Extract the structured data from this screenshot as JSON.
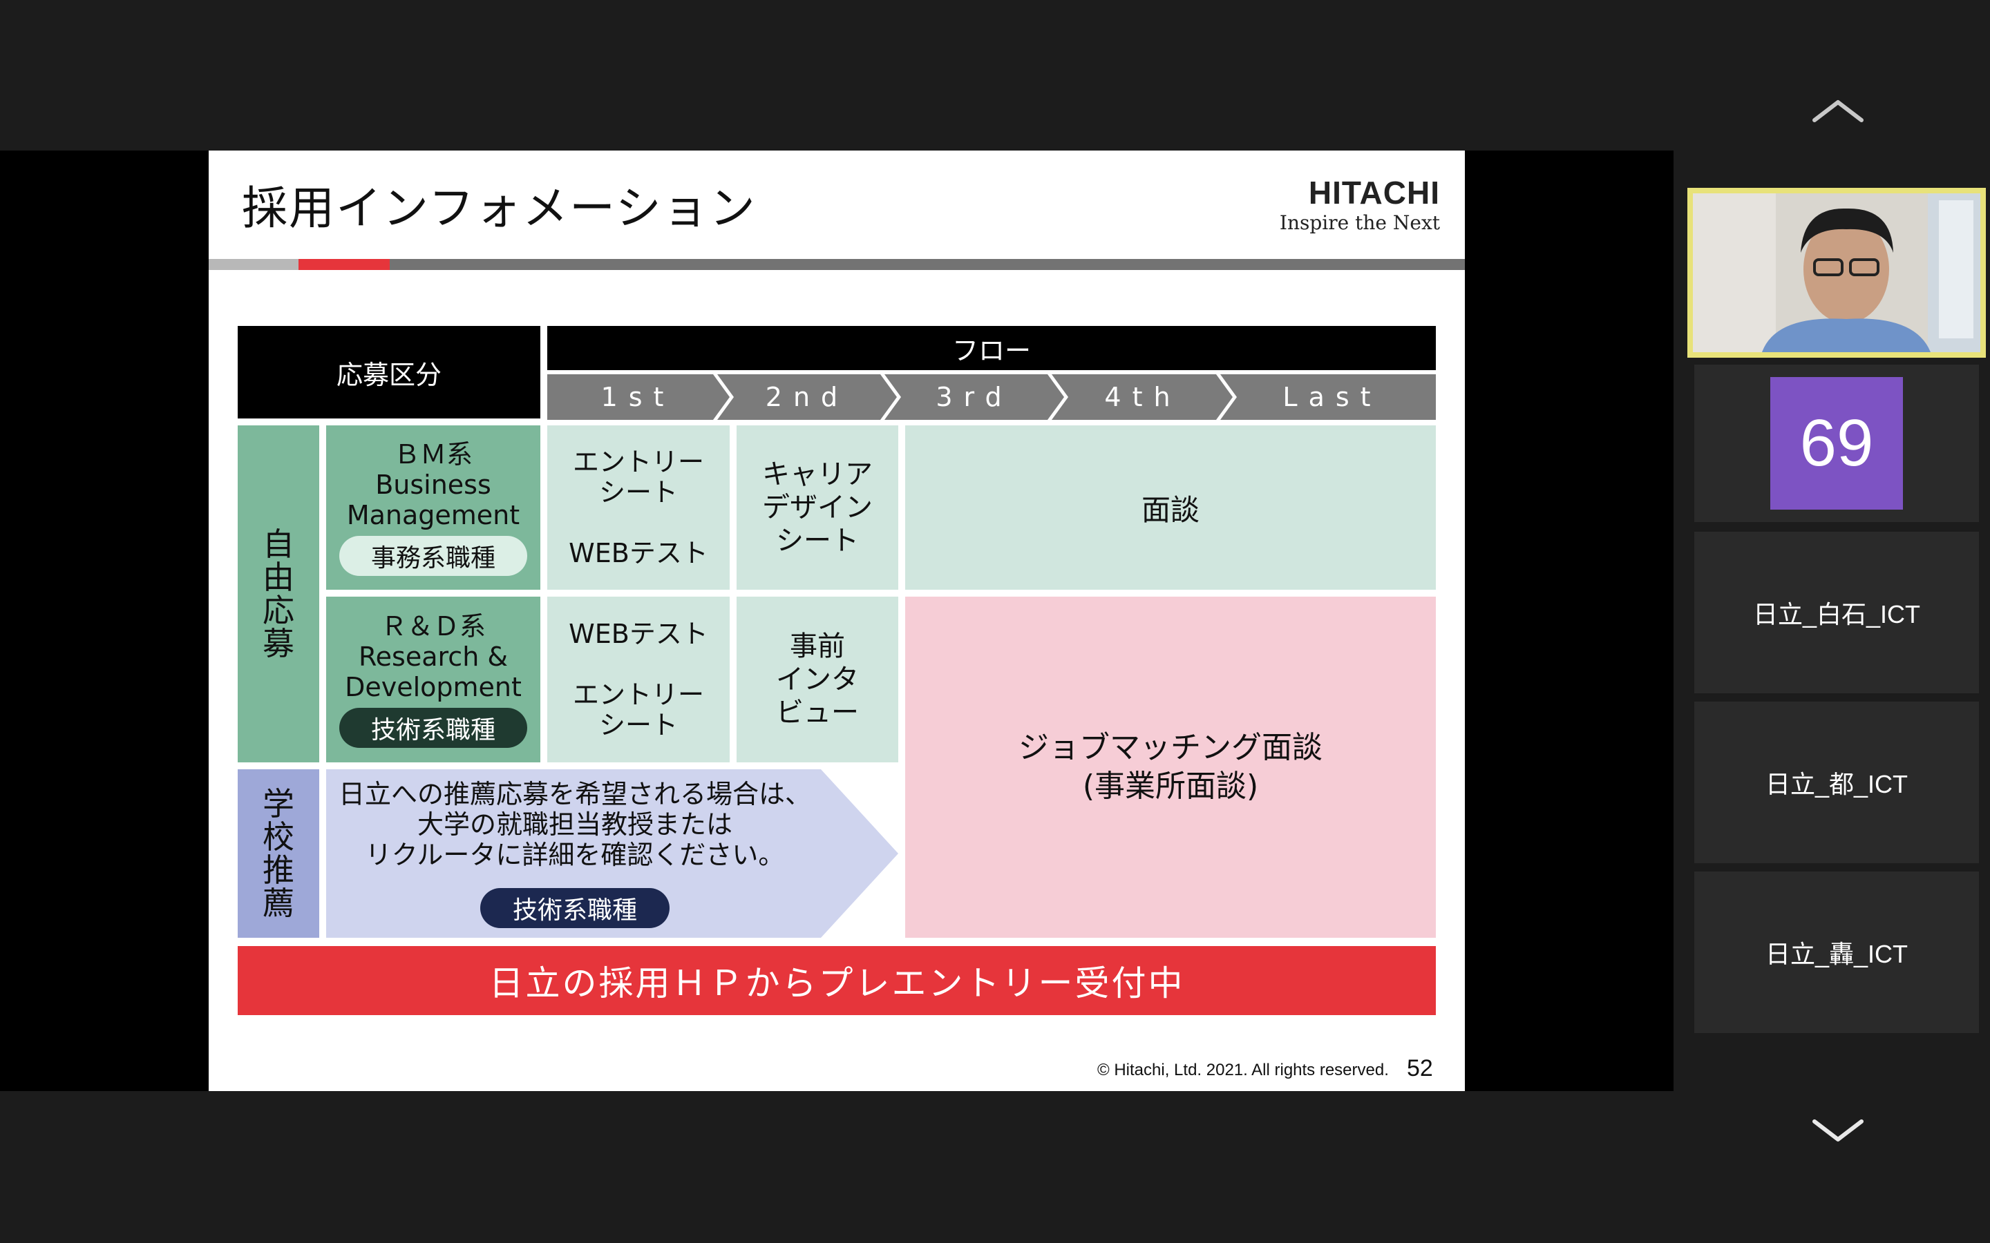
{
  "slide": {
    "title": "採用インフォメーション",
    "logo_name": "HITACHI",
    "logo_tagline": "Inspire the Next",
    "header_category": "応募区分",
    "header_flow": "フロー",
    "steps": [
      "1st",
      "2nd",
      "3rd",
      "4th",
      "Last"
    ],
    "free_application": "自由応募",
    "bm": {
      "title": "ＢＭ系",
      "line1": "Business",
      "line2": "Management",
      "tag": "事務系職種",
      "first": [
        "エントリー",
        "シート"
      ],
      "first_extra": "WEBテスト",
      "second": [
        "キャリア",
        "デザイン",
        "シート"
      ],
      "rest": "面談"
    },
    "rd": {
      "title": "Ｒ＆Ｄ系",
      "line1": "Research &",
      "line2": "Development",
      "tag": "技術系職種",
      "first_top": "WEBテスト",
      "first": [
        "エントリー",
        "シート"
      ],
      "second": [
        "事前",
        "インタ",
        "ビュー"
      ]
    },
    "matching": [
      "ジョブマッチング面談",
      "(事業所面談)"
    ],
    "school": {
      "label": "学校推薦",
      "text": [
        "日立への推薦応募を希望される場合は、",
        "大学の就職担当教授または",
        "リクルータに詳細を確認ください。"
      ],
      "tag": "技術系職種"
    },
    "banner": "日立の採用ＨＰからプレエントリー受付中",
    "copyright": "© Hitachi, Ltd. 2021. All rights reserved.",
    "page_number": "52"
  },
  "panel": {
    "participant_count": "69",
    "participants": [
      "日立_白石_ICT",
      "日立_都_ICT",
      "日立_轟_ICT"
    ],
    "scroll_up": "︿",
    "scroll_down": "﹀"
  },
  "colors": {
    "accent_red": "#e6353b",
    "dark_green": "#7db89b",
    "light_green": "#d0e6de",
    "pink": "#f6cdd6",
    "lavender": "#9ea8d8",
    "badge_purple": "#7d53c3",
    "active_speaker_border": "#e8e27a"
  }
}
